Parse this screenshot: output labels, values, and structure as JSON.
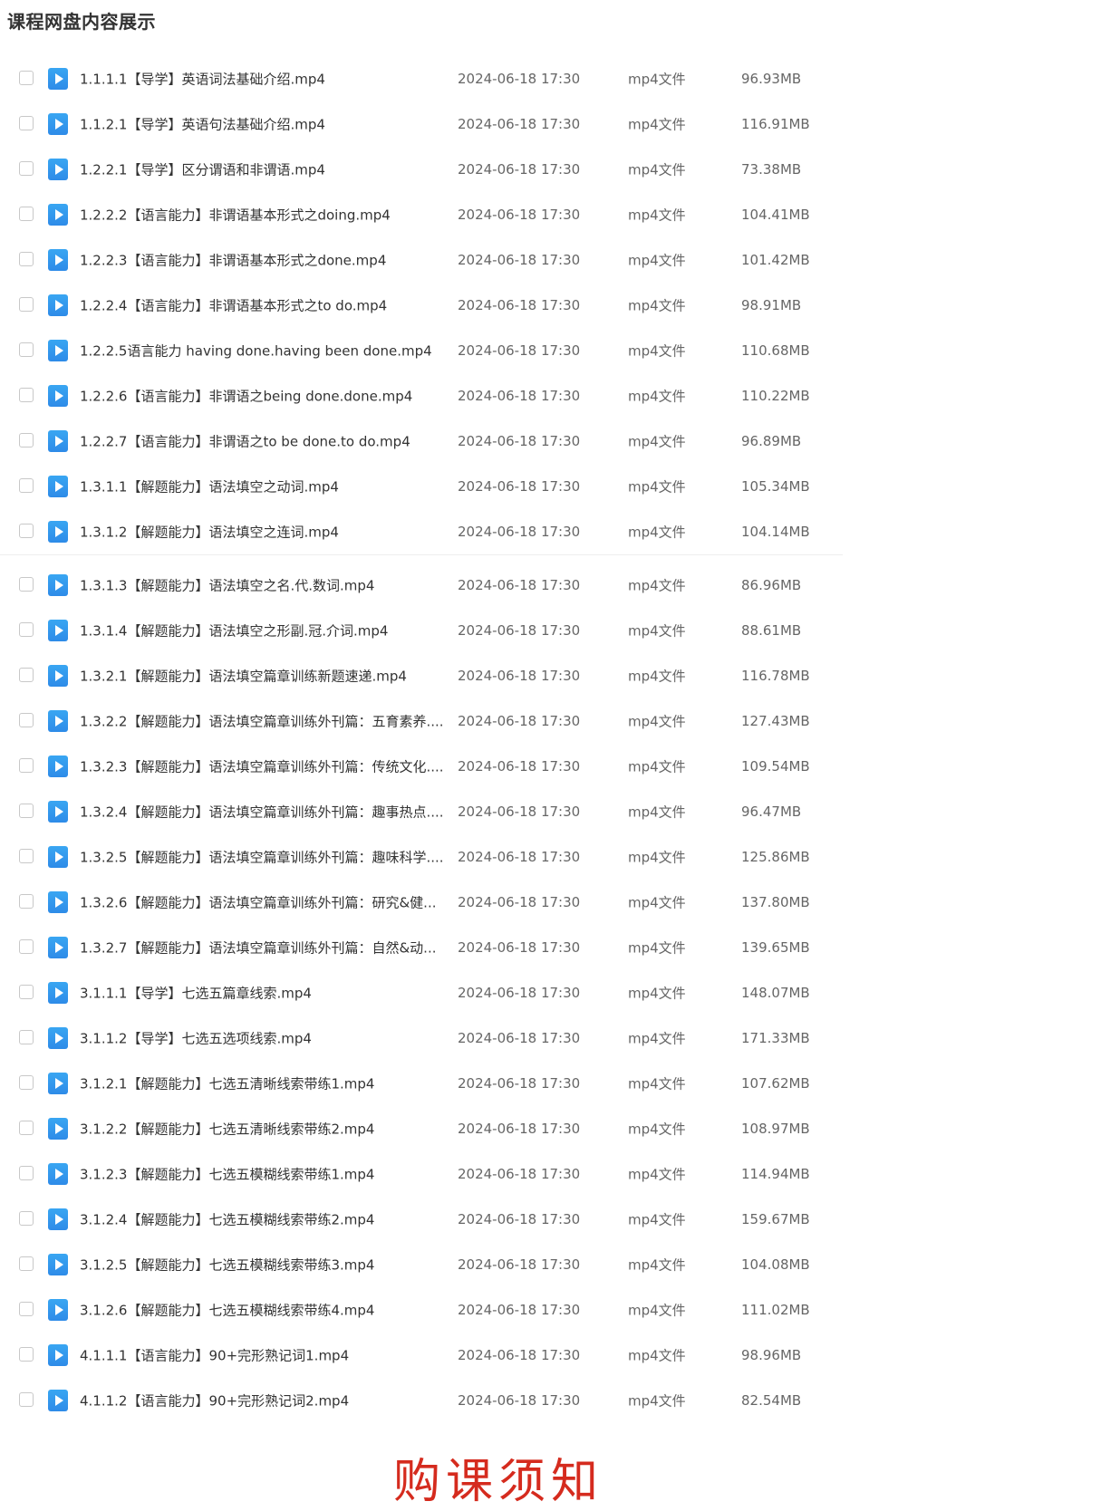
{
  "page": {
    "title": "课程网盘内容展示"
  },
  "files": [
    {
      "name": "1.1.1.1【导学】英语词法基础介绍.mp4",
      "date": "2024-06-18 17:30",
      "type": "mp4文件",
      "size": "96.93MB"
    },
    {
      "name": "1.1.2.1【导学】英语句法基础介绍.mp4",
      "date": "2024-06-18 17:30",
      "type": "mp4文件",
      "size": "116.91MB"
    },
    {
      "name": "1.2.2.1【导学】区分谓语和非谓语.mp4",
      "date": "2024-06-18 17:30",
      "type": "mp4文件",
      "size": "73.38MB"
    },
    {
      "name": "1.2.2.2【语言能力】非谓语基本形式之doing.mp4",
      "date": "2024-06-18 17:30",
      "type": "mp4文件",
      "size": "104.41MB"
    },
    {
      "name": "1.2.2.3【语言能力】非谓语基本形式之done.mp4",
      "date": "2024-06-18 17:30",
      "type": "mp4文件",
      "size": "101.42MB"
    },
    {
      "name": "1.2.2.4【语言能力】非谓语基本形式之to do.mp4",
      "date": "2024-06-18 17:30",
      "type": "mp4文件",
      "size": "98.91MB"
    },
    {
      "name": "1.2.2.5语言能力 having done.having been done.mp4",
      "date": "2024-06-18 17:30",
      "type": "mp4文件",
      "size": "110.68MB"
    },
    {
      "name": "1.2.2.6【语言能力】非谓语之being done.done.mp4",
      "date": "2024-06-18 17:30",
      "type": "mp4文件",
      "size": "110.22MB"
    },
    {
      "name": "1.2.2.7【语言能力】非谓语之to be done.to do.mp4",
      "date": "2024-06-18 17:30",
      "type": "mp4文件",
      "size": "96.89MB"
    },
    {
      "name": "1.3.1.1【解题能力】语法填空之动词.mp4",
      "date": "2024-06-18 17:30",
      "type": "mp4文件",
      "size": "105.34MB"
    },
    {
      "name": "1.3.1.2【解题能力】语法填空之连词.mp4",
      "date": "2024-06-18 17:30",
      "type": "mp4文件",
      "size": "104.14MB"
    },
    {
      "name": "1.3.1.3【解题能力】语法填空之名.代.数词.mp4",
      "date": "2024-06-18 17:30",
      "type": "mp4文件",
      "size": "86.96MB"
    },
    {
      "name": "1.3.1.4【解题能力】语法填空之形副.冠.介词.mp4",
      "date": "2024-06-18 17:30",
      "type": "mp4文件",
      "size": "88.61MB"
    },
    {
      "name": "1.3.2.1【解题能力】语法填空篇章训练新题速递.mp4",
      "date": "2024-06-18 17:30",
      "type": "mp4文件",
      "size": "116.78MB"
    },
    {
      "name": "1.3.2.2【解题能力】语法填空篇章训练外刊篇：五育素养....",
      "date": "2024-06-18 17:30",
      "type": "mp4文件",
      "size": "127.43MB"
    },
    {
      "name": "1.3.2.3【解题能力】语法填空篇章训练外刊篇：传统文化....",
      "date": "2024-06-18 17:30",
      "type": "mp4文件",
      "size": "109.54MB"
    },
    {
      "name": "1.3.2.4【解题能力】语法填空篇章训练外刊篇：趣事热点....",
      "date": "2024-06-18 17:30",
      "type": "mp4文件",
      "size": "96.47MB"
    },
    {
      "name": "1.3.2.5【解题能力】语法填空篇章训练外刊篇：趣味科学....",
      "date": "2024-06-18 17:30",
      "type": "mp4文件",
      "size": "125.86MB"
    },
    {
      "name": "1.3.2.6【解题能力】语法填空篇章训练外刊篇：研究&健...",
      "date": "2024-06-18 17:30",
      "type": "mp4文件",
      "size": "137.80MB"
    },
    {
      "name": "1.3.2.7【解题能力】语法填空篇章训练外刊篇：自然&动...",
      "date": "2024-06-18 17:30",
      "type": "mp4文件",
      "size": "139.65MB"
    },
    {
      "name": "3.1.1.1【导学】七选五篇章线索.mp4",
      "date": "2024-06-18 17:30",
      "type": "mp4文件",
      "size": "148.07MB"
    },
    {
      "name": "3.1.1.2【导学】七选五选项线索.mp4",
      "date": "2024-06-18 17:30",
      "type": "mp4文件",
      "size": "171.33MB"
    },
    {
      "name": "3.1.2.1【解题能力】七选五清晰线索带练1.mp4",
      "date": "2024-06-18 17:30",
      "type": "mp4文件",
      "size": "107.62MB"
    },
    {
      "name": "3.1.2.2【解题能力】七选五清晰线索带练2.mp4",
      "date": "2024-06-18 17:30",
      "type": "mp4文件",
      "size": "108.97MB"
    },
    {
      "name": "3.1.2.3【解题能力】七选五模糊线索带练1.mp4",
      "date": "2024-06-18 17:30",
      "type": "mp4文件",
      "size": "114.94MB"
    },
    {
      "name": "3.1.2.4【解题能力】七选五模糊线索带练2.mp4",
      "date": "2024-06-18 17:30",
      "type": "mp4文件",
      "size": "159.67MB"
    },
    {
      "name": "3.1.2.5【解题能力】七选五模糊线索带练3.mp4",
      "date": "2024-06-18 17:30",
      "type": "mp4文件",
      "size": "104.08MB"
    },
    {
      "name": "3.1.2.6【解题能力】七选五模糊线索带练4.mp4",
      "date": "2024-06-18 17:30",
      "type": "mp4文件",
      "size": "111.02MB"
    },
    {
      "name": "4.1.1.1【语言能力】90+完形熟记词1.mp4",
      "date": "2024-06-18 17:30",
      "type": "mp4文件",
      "size": "98.96MB"
    },
    {
      "name": "4.1.1.2【语言能力】90+完形熟记词2.mp4",
      "date": "2024-06-18 17:30",
      "type": "mp4文件",
      "size": "82.54MB"
    }
  ],
  "footer": {
    "notice": "购课须知"
  }
}
